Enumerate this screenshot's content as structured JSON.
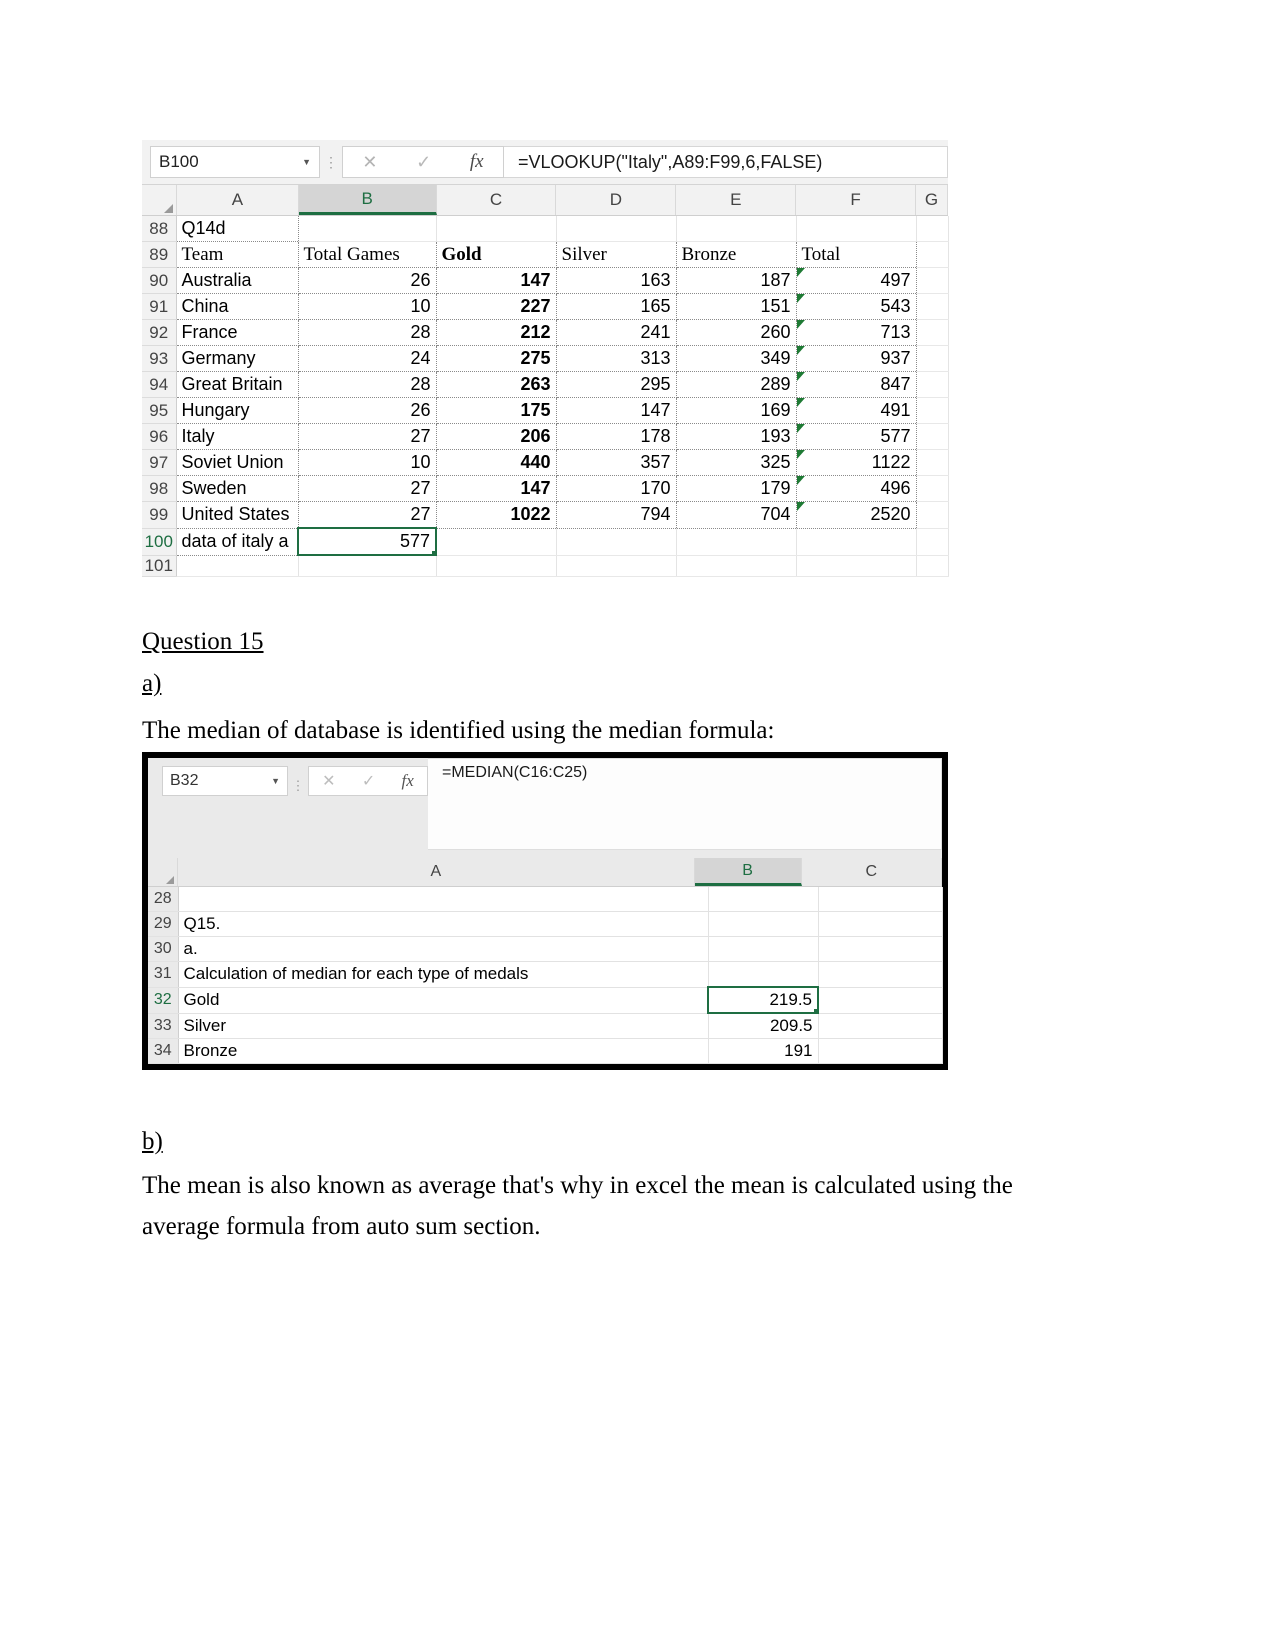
{
  "excel_top": {
    "name_box": "B100",
    "formula": "=VLOOKUP(\"Italy\",A89:F99,6,FALSE)",
    "icons": {
      "cancel": "✕",
      "confirm": "✓",
      "fx": "fx",
      "caret": "▼",
      "dots": "⋮"
    },
    "columns": [
      "A",
      "B",
      "C",
      "D",
      "E",
      "F",
      "G"
    ],
    "selected_column": "B",
    "rows": [
      {
        "num": "88",
        "cells": [
          "Q14d",
          "",
          "",
          "",
          "",
          "",
          ""
        ]
      },
      {
        "num": "89",
        "cells": [
          "Team",
          "Total Games",
          "Gold",
          "Silver",
          "Bronze",
          "Total",
          ""
        ]
      },
      {
        "num": "90",
        "cells": [
          "Australia",
          "26",
          "147",
          "163",
          "187",
          "497",
          ""
        ]
      },
      {
        "num": "91",
        "cells": [
          "China",
          "10",
          "227",
          "165",
          "151",
          "543",
          ""
        ]
      },
      {
        "num": "92",
        "cells": [
          "France",
          "28",
          "212",
          "241",
          "260",
          "713",
          ""
        ]
      },
      {
        "num": "93",
        "cells": [
          "Germany",
          "24",
          "275",
          "313",
          "349",
          "937",
          ""
        ]
      },
      {
        "num": "94",
        "cells": [
          "Great Britain",
          "28",
          "263",
          "295",
          "289",
          "847",
          ""
        ]
      },
      {
        "num": "95",
        "cells": [
          "Hungary",
          "26",
          "175",
          "147",
          "169",
          "491",
          ""
        ]
      },
      {
        "num": "96",
        "cells": [
          "Italy",
          "27",
          "206",
          "178",
          "193",
          "577",
          ""
        ]
      },
      {
        "num": "97",
        "cells": [
          "Soviet Union",
          "10",
          "440",
          "357",
          "325",
          "1122",
          ""
        ]
      },
      {
        "num": "98",
        "cells": [
          "Sweden",
          "27",
          "147",
          "170",
          "179",
          "496",
          ""
        ]
      },
      {
        "num": "99",
        "cells": [
          "United States",
          "27",
          "1022",
          "794",
          "704",
          "2520",
          ""
        ]
      },
      {
        "num": "100",
        "cells": [
          "data of italy a",
          "577",
          "",
          "",
          "",
          "",
          ""
        ]
      },
      {
        "num": "101",
        "cells": [
          "",
          "",
          "",
          "",
          "",
          "",
          ""
        ]
      }
    ]
  },
  "document": {
    "question_heading": "Question 15",
    "part_a_label": "a)",
    "part_a_text": "The median of database is identified using the median formula:",
    "part_b_label": "b)",
    "part_b_text": "The mean is also known as average that's why in excel the mean is calculated using the average formula from auto sum section."
  },
  "excel_bottom": {
    "name_box": "B32",
    "formula": "=MEDIAN(C16:C25)",
    "icons": {
      "cancel": "✕",
      "confirm": "✓",
      "fx": "fx",
      "caret": "▼",
      "dots": "⋮"
    },
    "columns": [
      "A",
      "B",
      "C"
    ],
    "selected_column": "B",
    "rows": [
      {
        "num": "28",
        "a": "",
        "b": "",
        "c": ""
      },
      {
        "num": "29",
        "a": "Q15.",
        "b": "",
        "c": ""
      },
      {
        "num": "30",
        "a": "a.",
        "b": "",
        "c": ""
      },
      {
        "num": "31",
        "a": "Calculation of median for each type of medals",
        "b": "",
        "c": ""
      },
      {
        "num": "32",
        "a": "Gold",
        "b": "219.5",
        "c": ""
      },
      {
        "num": "33",
        "a": "Silver",
        "b": "209.5",
        "c": ""
      },
      {
        "num": "34",
        "a": "Bronze",
        "b": "191",
        "c": ""
      }
    ]
  },
  "colors": {
    "excel_accent_green": "#1e6e42",
    "comment_marker_green": "#1e7a34",
    "header_gray": "#f2f2f2"
  }
}
